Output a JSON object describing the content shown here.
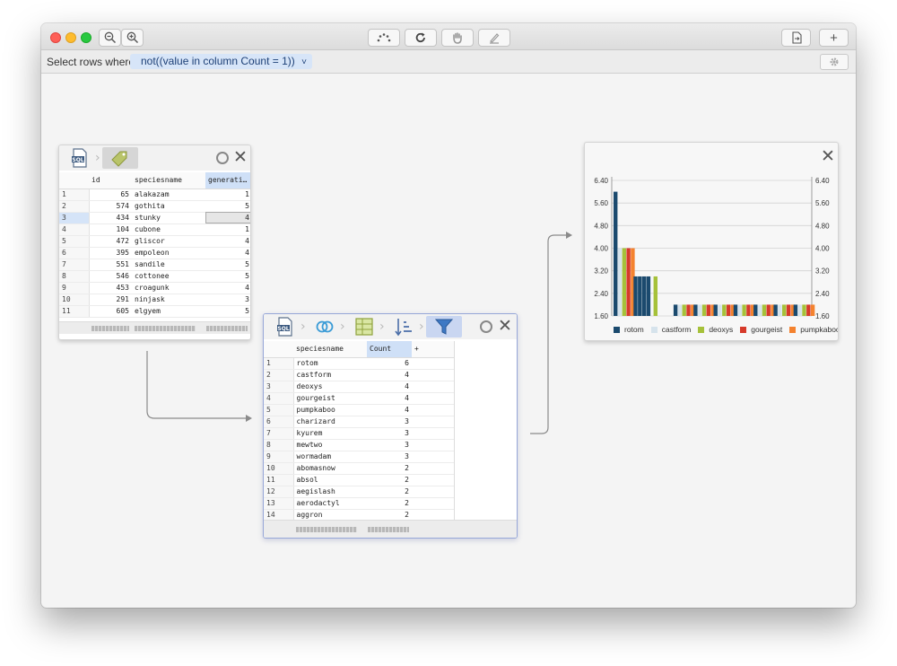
{
  "filter": {
    "label": "Select rows where",
    "expression": "not((value in column Count = 1))",
    "chevron": "˅"
  },
  "toolbar": {
    "zoom_out_icon": "zoom-out-icon",
    "zoom_in_icon": "zoom-in-icon",
    "add_label": "+"
  },
  "source_table": {
    "headers": [
      "id",
      "speciesname",
      "generati…"
    ],
    "rows": [
      {
        "n": "1",
        "id": "65",
        "name": "alakazam",
        "gen": "1"
      },
      {
        "n": "2",
        "id": "574",
        "name": "gothita",
        "gen": "5"
      },
      {
        "n": "3",
        "id": "434",
        "name": "stunky",
        "gen": "4"
      },
      {
        "n": "4",
        "id": "104",
        "name": "cubone",
        "gen": "1"
      },
      {
        "n": "5",
        "id": "472",
        "name": "gliscor",
        "gen": "4"
      },
      {
        "n": "6",
        "id": "395",
        "name": "empoleon",
        "gen": "4"
      },
      {
        "n": "7",
        "id": "551",
        "name": "sandile",
        "gen": "5"
      },
      {
        "n": "8",
        "id": "546",
        "name": "cottonee",
        "gen": "5"
      },
      {
        "n": "9",
        "id": "453",
        "name": "croagunk",
        "gen": "4"
      },
      {
        "n": "10",
        "id": "291",
        "name": "ninjask",
        "gen": "3"
      },
      {
        "n": "11",
        "id": "605",
        "name": "elgyem",
        "gen": "5"
      }
    ]
  },
  "result_table": {
    "headers": [
      "speciesname",
      "Count",
      "+"
    ],
    "rows": [
      {
        "n": "1",
        "name": "rotom",
        "count": "6"
      },
      {
        "n": "2",
        "name": "castform",
        "count": "4"
      },
      {
        "n": "3",
        "name": "deoxys",
        "count": "4"
      },
      {
        "n": "4",
        "name": "gourgeist",
        "count": "4"
      },
      {
        "n": "5",
        "name": "pumpkaboo",
        "count": "4"
      },
      {
        "n": "6",
        "name": "charizard",
        "count": "3"
      },
      {
        "n": "7",
        "name": "kyurem",
        "count": "3"
      },
      {
        "n": "8",
        "name": "mewtwo",
        "count": "3"
      },
      {
        "n": "9",
        "name": "wormadam",
        "count": "3"
      },
      {
        "n": "10",
        "name": "abomasnow",
        "count": "2"
      },
      {
        "n": "11",
        "name": "absol",
        "count": "2"
      },
      {
        "n": "12",
        "name": "aegislash",
        "count": "2"
      },
      {
        "n": "13",
        "name": "aerodactyl",
        "count": "2"
      },
      {
        "n": "14",
        "name": "aggron",
        "count": "2"
      }
    ]
  },
  "close_glyph": "✕",
  "colors": {
    "series": [
      "#1b4a6e",
      "#d6e3ec",
      "#a6c13a",
      "#d63a2a",
      "#f4822f"
    ],
    "connector": "#8a8a8a",
    "selection": "#cfe0f7"
  },
  "chart_data": {
    "type": "bar",
    "ylim": [
      1.6,
      6.4
    ],
    "y_ticks": [
      "6.40",
      "5.60",
      "4.80",
      "4.00",
      "3.20",
      "2.40",
      "1.60"
    ],
    "legend": [
      "rotom",
      "castform",
      "deoxys",
      "gourgeist",
      "pumpkaboo"
    ],
    "groups": [
      [
        6,
        4,
        4,
        4,
        4
      ],
      [
        3,
        3,
        3,
        3
      ],
      [
        3
      ],
      [
        2,
        2,
        2,
        2,
        2
      ],
      [
        2,
        2,
        2,
        2,
        2
      ],
      [
        2,
        2,
        2,
        2,
        2
      ],
      [
        2,
        2,
        2,
        2,
        2
      ],
      [
        2,
        2,
        2,
        2,
        2
      ],
      [
        2,
        2,
        2,
        2,
        2
      ],
      [
        2,
        2,
        2,
        2,
        2
      ]
    ],
    "group_colors": [
      [
        "#1b4a6e",
        "#d6e3ec",
        "#a6c13a",
        "#d63a2a",
        "#f4822f"
      ],
      [
        "#1b4a6e",
        "#1b4a6e",
        "#1b4a6e",
        "#1b4a6e"
      ],
      [
        "#a6c13a"
      ],
      [
        "#1b4a6e",
        "#d6e3ec",
        "#a6c13a",
        "#d63a2a",
        "#f4822f"
      ],
      [
        "#1b4a6e",
        "#d6e3ec",
        "#a6c13a",
        "#d63a2a",
        "#f4822f"
      ],
      [
        "#1b4a6e",
        "#d6e3ec",
        "#a6c13a",
        "#d63a2a",
        "#f4822f"
      ],
      [
        "#1b4a6e",
        "#d6e3ec",
        "#a6c13a",
        "#d63a2a",
        "#f4822f"
      ],
      [
        "#1b4a6e",
        "#d6e3ec",
        "#a6c13a",
        "#d63a2a",
        "#f4822f"
      ],
      [
        "#1b4a6e",
        "#d6e3ec",
        "#a6c13a",
        "#d63a2a",
        "#f4822f"
      ],
      [
        "#1b4a6e",
        "#d6e3ec",
        "#a6c13a",
        "#d63a2a",
        "#f4822f"
      ]
    ],
    "grid": true,
    "legend_position": "bottom"
  }
}
